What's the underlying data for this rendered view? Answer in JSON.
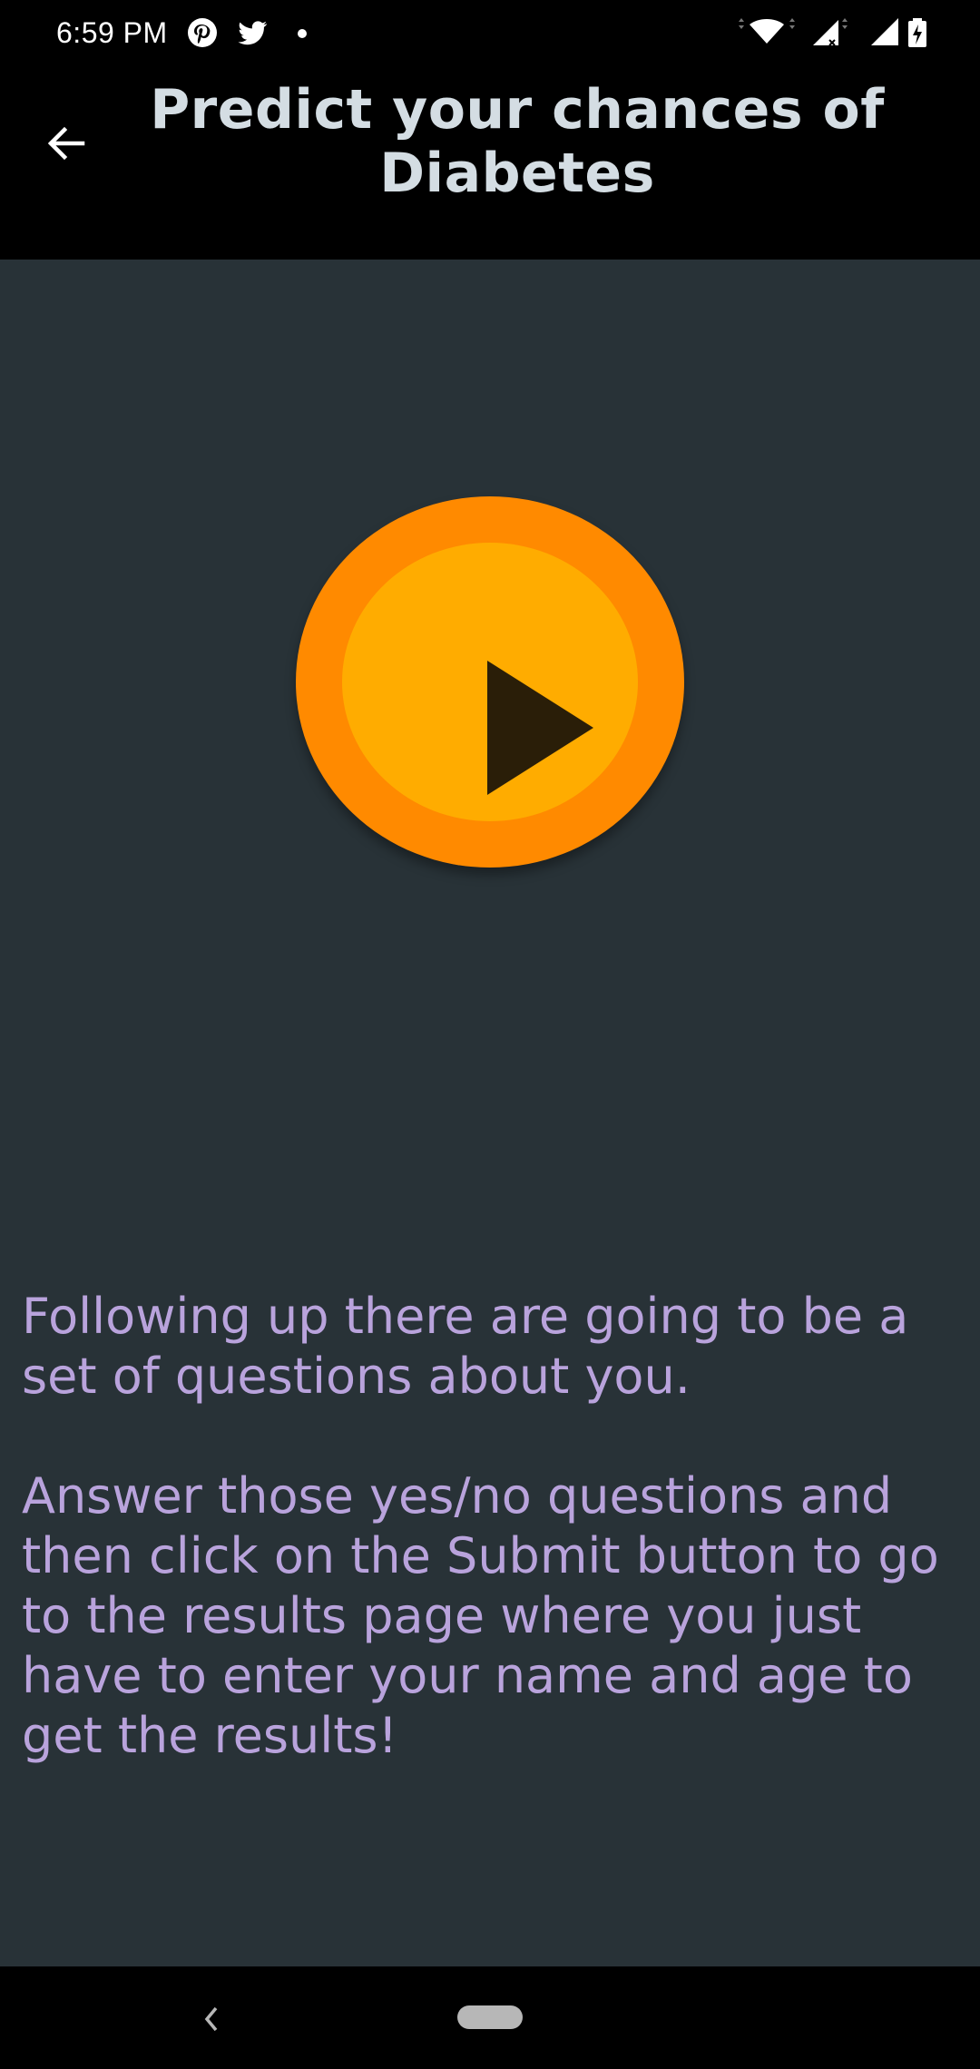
{
  "status_bar": {
    "time": "6:59 PM",
    "icons": [
      "pinterest-icon",
      "twitter-icon",
      "notification-dot-icon",
      "wifi-icon",
      "signal-icon",
      "signal-icon",
      "battery-icon"
    ]
  },
  "header": {
    "title": "Predict your chances of Diabetes",
    "back_icon": "arrow-left-icon"
  },
  "play_button": {
    "icon": "play-icon",
    "colors": {
      "outer": "#ff8a00",
      "inner": "#ffac00",
      "triangle": "#2a1e08"
    }
  },
  "description": {
    "paragraph1": "Following up there are going to be a set of questions about you.",
    "paragraph2": "Answer those yes/no questions and then click on the Submit button to go to the results page where you just have to enter your name and age to get the results!"
  },
  "colors": {
    "background": "#283237",
    "header_background": "#000000",
    "title_text": "#d4dde3",
    "description_text": "#b9a3dc"
  },
  "nav_bar": {
    "back_icon": "chevron-left-icon",
    "home_icon": "home-pill-icon"
  }
}
